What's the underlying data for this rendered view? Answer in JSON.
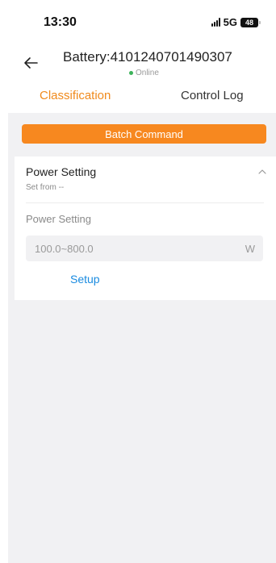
{
  "status_bar": {
    "time": "13:30",
    "network": "5G",
    "battery_level": "48"
  },
  "header": {
    "back_icon": "arrow-left-icon",
    "title": "Battery:4101240701490307",
    "online_status": "Online",
    "online_color": "#3cb35a"
  },
  "tabs": [
    {
      "label": "Classification",
      "active": true
    },
    {
      "label": "Control Log",
      "active": false
    }
  ],
  "accent_color": "#f7881f",
  "batch_command_label": "Batch Command",
  "power_card": {
    "title": "Power Setting",
    "subtitle": "Set from --",
    "collapse_icon": "chevron-up-icon",
    "field_label": "Power Setting",
    "input_placeholder": "100.0~800.0",
    "unit": "W",
    "setup_label": "Setup"
  }
}
